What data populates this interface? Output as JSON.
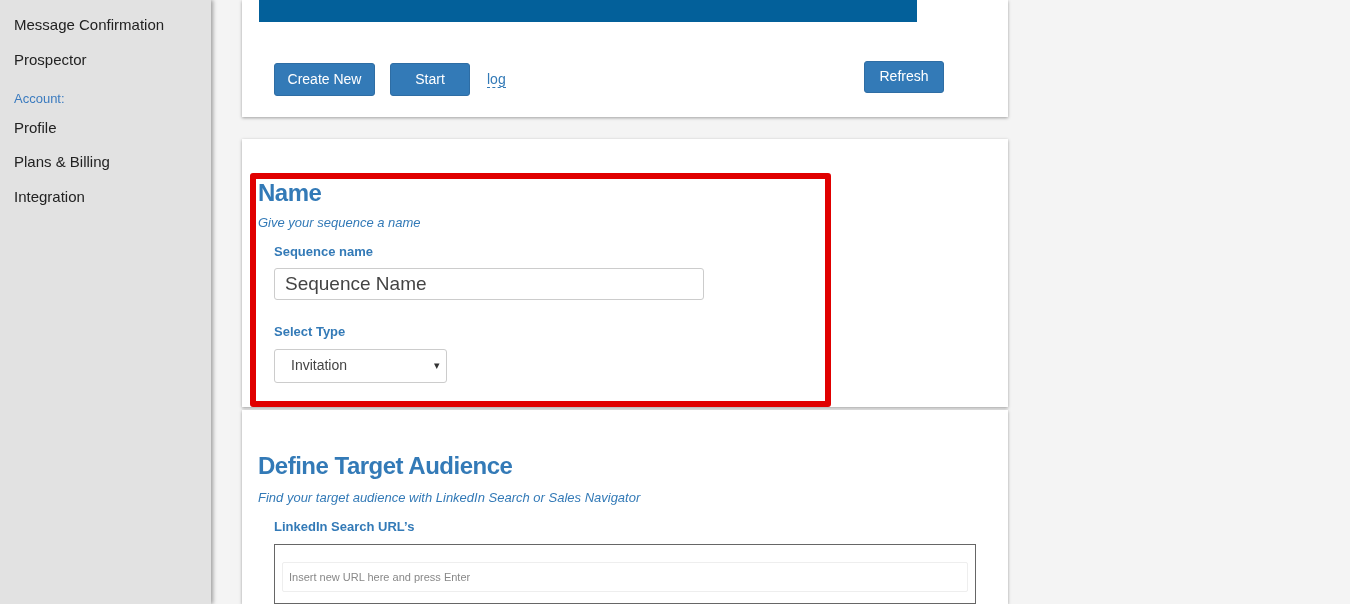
{
  "sidebar": {
    "items": [
      {
        "kind": "link",
        "label": "Message Confirmation"
      },
      {
        "kind": "link",
        "label": "Prospector"
      },
      {
        "kind": "heading",
        "label": "Account:"
      },
      {
        "kind": "link",
        "label": "Profile"
      },
      {
        "kind": "link",
        "label": "Plans & Billing"
      },
      {
        "kind": "link",
        "label": "Integration"
      }
    ]
  },
  "sequences_panel": {
    "buttons": [
      "Create New",
      "Start"
    ],
    "log_link": "log",
    "refresh_button": "Refresh"
  },
  "name_section": {
    "title": "Name",
    "subtitle": "Give your sequence a name",
    "name_label": "Sequence name",
    "name_value": "Sequence Name",
    "type_label": "Select Type",
    "type_value": "Invitation",
    "type_caret": "▾",
    "highlighted": true
  },
  "audience_section": {
    "title": "Define Target Audience",
    "subtitle": "Find your target audience with LinkedIn Search or Sales Navigator",
    "urls_label": "LinkedIn Search URL’s",
    "url_placeholder": "Insert new URL here and press Enter"
  }
}
